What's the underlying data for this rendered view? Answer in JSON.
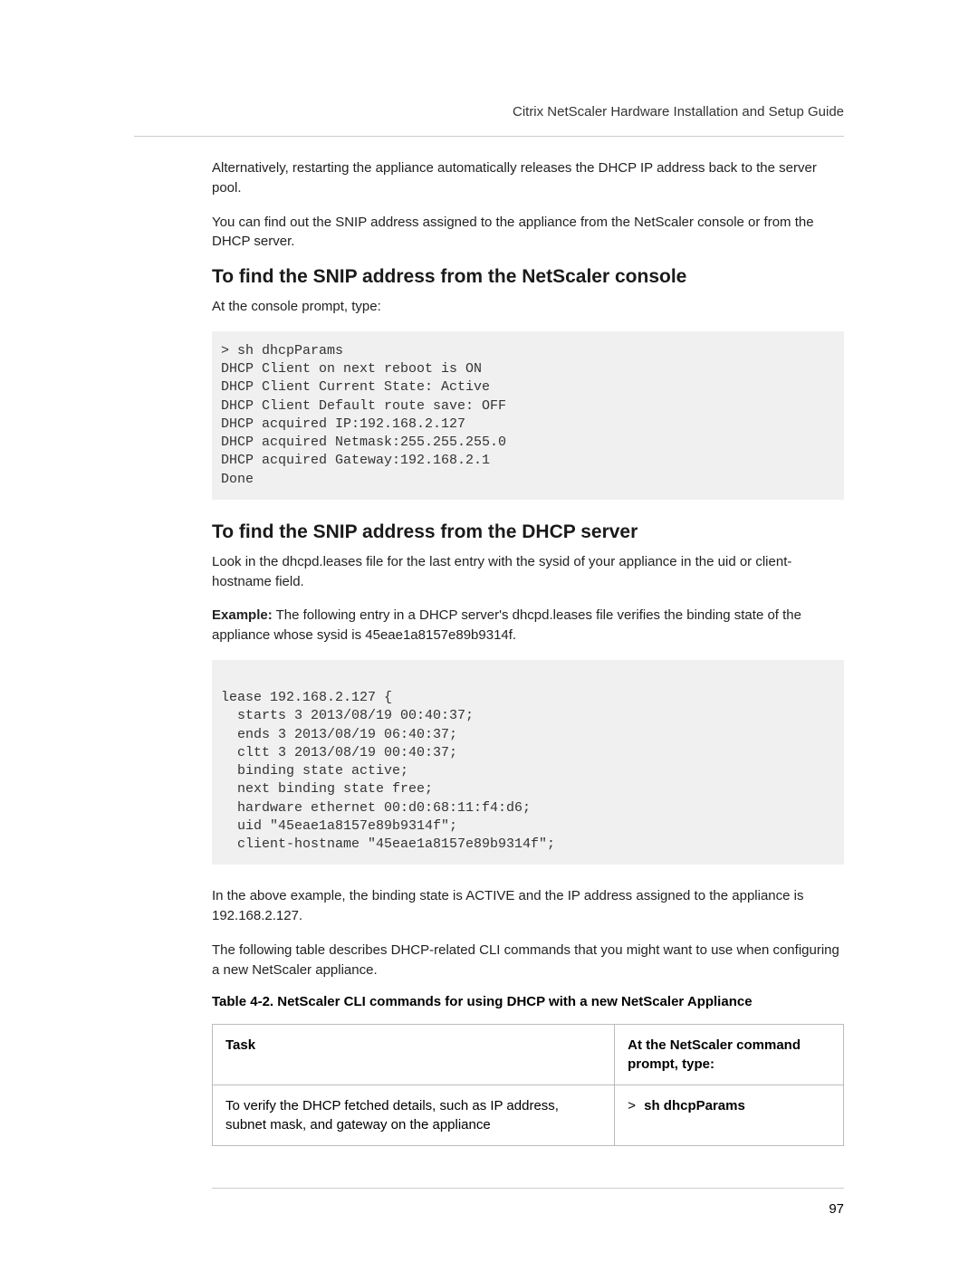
{
  "header": {
    "doc_title": "Citrix NetScaler Hardware Installation and Setup Guide"
  },
  "body": {
    "p1": "Alternatively, restarting the appliance automatically releases the DHCP IP address back to the server pool.",
    "p2": "You can find out the SNIP address assigned to the appliance from the NetScaler console or from the DHCP server.",
    "h1": "To find the SNIP address from the NetScaler console",
    "p3": "At the console prompt, type:",
    "code1": "> sh dhcpParams\nDHCP Client on next reboot is ON\nDHCP Client Current State: Active\nDHCP Client Default route save: OFF\nDHCP acquired IP:192.168.2.127\nDHCP acquired Netmask:255.255.255.0\nDHCP acquired Gateway:192.168.2.1\nDone",
    "h2": "To find the SNIP address from the DHCP server",
    "p4": "Look in the dhcpd.leases file for the last entry with the sysid of your appliance in the uid or client-hostname field.",
    "p5_label": "Example:",
    "p5_text": " The following entry in a DHCP server's dhcpd.leases file verifies the binding state of the appliance whose sysid is 45eae1a8157e89b9314f.",
    "code2": "\nlease 192.168.2.127 {\n  starts 3 2013/08/19 00:40:37;\n  ends 3 2013/08/19 06:40:37;\n  cltt 3 2013/08/19 00:40:37;\n  binding state active;\n  next binding state free;\n  hardware ethernet 00:d0:68:11:f4:d6;\n  uid \"45eae1a8157e89b9314f\";\n  client-hostname \"45eae1a8157e89b9314f\";",
    "p6": "In the above example, the binding state is ACTIVE and the IP address assigned to the appliance is 192.168.2.127.",
    "p7": "The following table describes DHCP-related CLI commands that you might want to use when configuring a new NetScaler appliance.",
    "table_caption": "Table 4-2. NetScaler CLI commands for using DHCP with a new NetScaler Appliance",
    "table": {
      "header_task": "Task",
      "header_cmd": "At the NetScaler command prompt, type:",
      "row1_task": "To verify the DHCP fetched details, such as IP address, subnet mask, and gateway on the appliance",
      "row1_cmd_prefix": "> ",
      "row1_cmd": "sh dhcpParams"
    }
  },
  "footer": {
    "page_number": "97"
  }
}
